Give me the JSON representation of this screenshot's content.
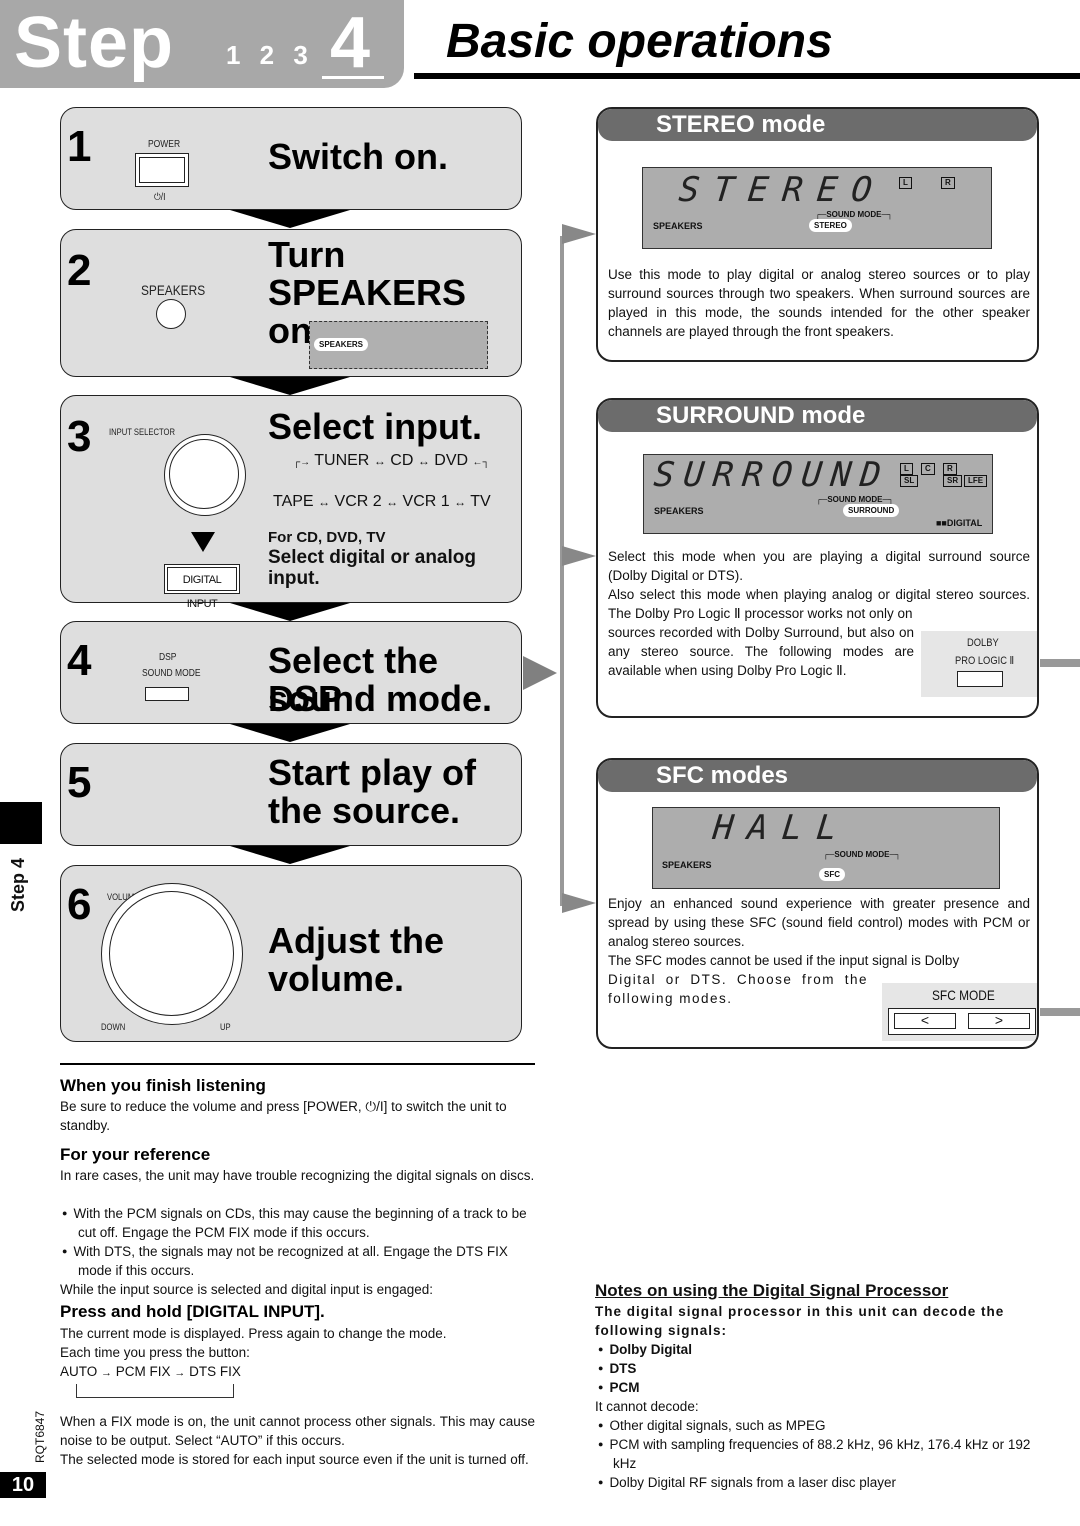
{
  "header": {
    "step_word": "Step",
    "step_numbers": "1 2 3",
    "current_step": "4",
    "title": "Basic operations"
  },
  "side_tab": {
    "label": "Step 4"
  },
  "footer": {
    "doc_code": "RQT6847",
    "page_number": "10"
  },
  "steps": [
    {
      "number": "1",
      "title": "Switch on.",
      "control_label": "POWER",
      "control_symbol": "⏻/I"
    },
    {
      "number": "2",
      "title_line1": "Turn",
      "title_line2": "SPEAKERS on.",
      "control_label": "SPEAKERS",
      "display_indicator": "SPEAKERS"
    },
    {
      "number": "3",
      "title": "Select input.",
      "control_label": "INPUT SELECTOR",
      "sources_row1": [
        "TUNER",
        "CD",
        "DVD"
      ],
      "sources_row2": [
        "TAPE",
        "VCR 2",
        "VCR 1",
        "TV"
      ],
      "sub_heading": "For CD, DVD, TV",
      "sub_title_line1": "Select digital or analog",
      "sub_title_line2": "input.",
      "button_label": "DIGITAL INPUT"
    },
    {
      "number": "4",
      "title_line1": "Select the DSP",
      "title_line2": "sound mode.",
      "control_label_line1": "DSP",
      "control_label_line2": "SOUND MODE"
    },
    {
      "number": "5",
      "title_line1": "Start play of",
      "title_line2": "the source."
    },
    {
      "number": "6",
      "title_line1": "Adjust the",
      "title_line2": "volume.",
      "control_label": "VOLUME",
      "down_label": "DOWN",
      "up_label": "UP"
    }
  ],
  "modes": [
    {
      "title": "STEREO mode",
      "display_text": "STEREO",
      "speakers_label": "SPEAKERS",
      "sound_mode_label": "SOUND MODE",
      "mode_indicator": "STEREO",
      "channels": [
        "L",
        "R"
      ],
      "description": "Use this mode to play digital or analog stereo sources or to play surround sources through two speakers. When surround sources are played in this mode, the sounds intended for the other speaker channels are played through the front speakers."
    },
    {
      "title": "SURROUND mode",
      "display_text": "SURROUND",
      "speakers_label": "SPEAKERS",
      "sound_mode_label": "SOUND MODE",
      "mode_indicator": "SURROUND",
      "channels_top": [
        "L",
        "C",
        "R"
      ],
      "channels_bottom": [
        "SL",
        "SR",
        "LFE"
      ],
      "digital_badge": "DIGITAL",
      "description_p1": "Select this mode when you are playing a digital surround source (Dolby Digital or DTS).",
      "description_p2_full": "Also select this mode when playing analog or digital stereo sources. The Dolby Pro Logic Ⅱ processor works not only on",
      "description_p2_wrap": "sources recorded with Dolby Surround, but also on any stereo source. The following modes are available when using Dolby Pro Logic Ⅱ.",
      "button_label_line1": "DOLBY",
      "button_label_line2": "PRO LOGIC Ⅱ"
    },
    {
      "title": "SFC modes",
      "display_text": "HALL",
      "speakers_label": "SPEAKERS",
      "sound_mode_label": "SOUND MODE",
      "mode_indicator": "SFC",
      "description_p1": "Enjoy an enhanced sound experience with greater presence and spread by using these SFC (sound field control) modes with PCM or analog stereo sources.",
      "description_p2_full": "The SFC modes cannot be used if the input signal is Dolby",
      "description_p2_wrap": "Digital or DTS. Choose from the following modes.",
      "button_label": "SFC MODE",
      "prev_label": "<",
      "next_label": ">"
    }
  ],
  "finish": {
    "heading": "When you finish listening",
    "text": "Be sure to reduce the volume and press [POWER, ⏻/I] to switch the unit to standby."
  },
  "reference": {
    "heading": "For your reference",
    "intro": "In rare cases, the unit may have trouble recognizing the digital signals on discs.",
    "bullets": [
      "With the PCM signals on CDs, this may cause the beginning of a track to be cut off. Engage the PCM FIX mode if this occurs.",
      "With DTS, the signals may not be recognized at all. Engage the DTS FIX mode if this occurs."
    ],
    "condition": "While the input source is selected and digital input is engaged:",
    "action_heading": "Press and hold [DIGITAL INPUT].",
    "action_text1": "The current mode is displayed. Press again to change the mode.",
    "action_text2": "Each time you press the button:",
    "cycle": [
      "AUTO",
      "PCM FIX",
      "DTS FIX"
    ],
    "note1": "When a FIX mode is on, the unit cannot process other signals. This may cause noise to be output. Select “AUTO” if this occurs.",
    "note2": "The selected mode is stored for each input source even if the unit is turned off."
  },
  "dsp_notes": {
    "heading": "Notes on using the Digital Signal Processor",
    "intro": "The digital signal processor in this unit can decode the following signals:",
    "can_decode": [
      "Dolby Digital",
      "DTS",
      "PCM"
    ],
    "cannot_heading": "It cannot decode:",
    "cannot_decode": [
      "Other digital signals, such as MPEG",
      "PCM with sampling frequencies of 88.2 kHz, 96 kHz, 176.4 kHz or 192 kHz",
      "Dolby Digital RF signals from a laser disc player"
    ]
  }
}
